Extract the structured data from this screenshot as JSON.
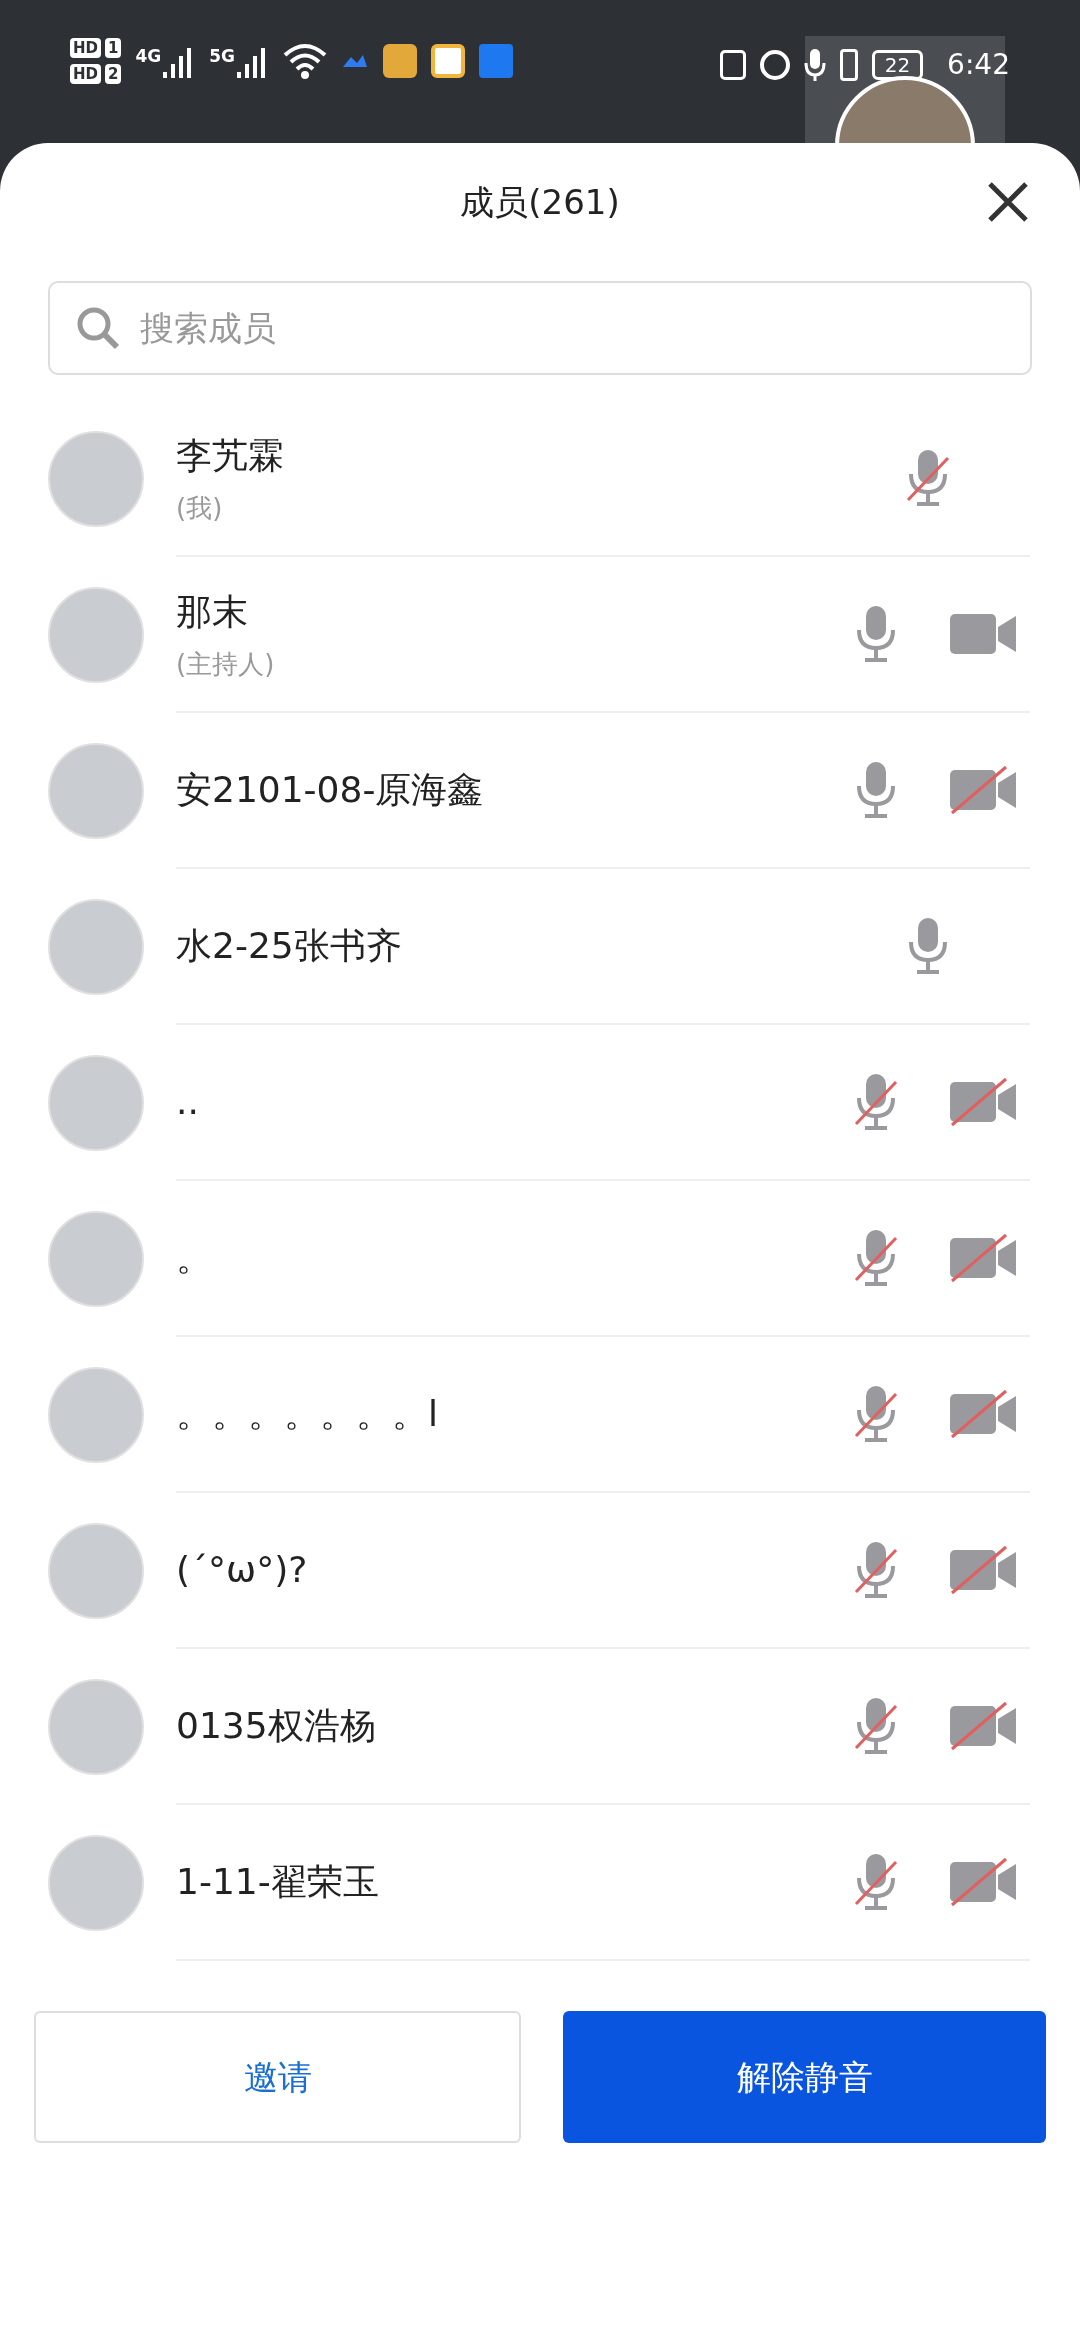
{
  "status_bar": {
    "sim_labels": [
      {
        "hd": "HD",
        "slot": "1"
      },
      {
        "hd": "HD",
        "slot": "2"
      }
    ],
    "networks": [
      "4G",
      "5G"
    ],
    "battery": "22",
    "time": "6:42"
  },
  "panel": {
    "title": "成员(261)",
    "search": {
      "placeholder": "搜索成员"
    }
  },
  "members": [
    {
      "name": "李艽霖",
      "role": "(我)",
      "mic_muted": true
    },
    {
      "name": "那末",
      "role": "(主持人)",
      "mic_muted": false,
      "camera": {
        "off": false
      }
    },
    {
      "name": "安2101-08-原海鑫",
      "mic_muted": false,
      "camera": {
        "off": true
      }
    },
    {
      "name": "水2-25张书齐",
      "mic_muted": false
    },
    {
      "name": "..",
      "mic_muted": true,
      "camera": {
        "off": true
      }
    },
    {
      "name": "。",
      "mic_muted": true,
      "camera": {
        "off": true
      }
    },
    {
      "name": "。。。。。。。l",
      "mic_muted": true,
      "camera": {
        "off": true
      }
    },
    {
      "name": "(´°ω°)?",
      "mic_muted": true,
      "camera": {
        "off": true
      }
    },
    {
      "name": "0135权浩杨",
      "mic_muted": true,
      "camera": {
        "off": true
      }
    },
    {
      "name": "1-11-翟荣玉",
      "mic_muted": true,
      "camera": {
        "off": true
      }
    }
  ],
  "buttons": [
    {
      "label": "邀请",
      "kind": "secondary"
    },
    {
      "label": "解除静音",
      "kind": "primary"
    }
  ]
}
